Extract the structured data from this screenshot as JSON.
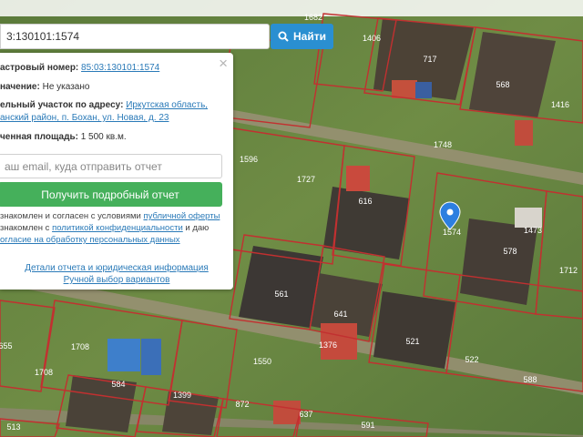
{
  "search": {
    "value": "3:130101:1574",
    "button_label": "Найти"
  },
  "panel": {
    "cadastral_label": "астровый номер:",
    "cadastral_value": "85:03:130101:1574",
    "purpose_label": "начение:",
    "purpose_value": "Не указано",
    "address_label": "ельный участок по адресу:",
    "address_line1": "Иркутская область,",
    "address_line2": "анский район, п. Бохан, ул. Новая, д. 23",
    "area_label": "ченная площадь:",
    "area_value": "1 500 кв.м.",
    "email_placeholder": "аш email, куда отправить отчет",
    "report_button": "Получить подробный отчет",
    "consent_1a": "знакомлен и согласен с условиями ",
    "consent_1b": "публичной оферты",
    "consent_2a": "знакомлен с ",
    "consent_2b": "политикой конфиденциальности",
    "consent_2c": " и даю",
    "consent_3": "огласие на обработку персональных данных",
    "details_link": "Детали отчета и юридическая информация",
    "manual_link": "Ручной выбор вариантов",
    "close_symbol": "×"
  },
  "map": {
    "marker_color": "#2d7fe0",
    "parcel_labels": [
      "1682",
      "1406",
      "717",
      "568",
      "1416",
      "1748",
      "1596",
      "1727",
      "616",
      "1574",
      "578",
      "1473",
      "1712",
      "561",
      "641",
      "1376",
      "521",
      "1708",
      "1550",
      "522",
      "588",
      "584",
      "1399",
      "872",
      "637",
      "591",
      "513",
      "655"
    ]
  }
}
